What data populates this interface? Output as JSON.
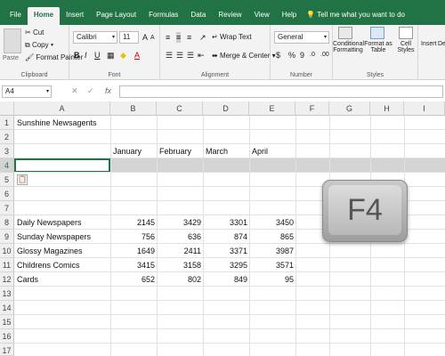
{
  "tabs": [
    "File",
    "Home",
    "Insert",
    "Page Layout",
    "Formulas",
    "Data",
    "Review",
    "View",
    "Help"
  ],
  "tell_me": "Tell me what you want to do",
  "clipboard": {
    "paste": "Paste",
    "cut": "Cut",
    "copy": "Copy",
    "format_painter": "Format Painter",
    "label": "Clipboard"
  },
  "font": {
    "name": "Calibri",
    "size": "11",
    "bold": "B",
    "italic": "I",
    "underline": "U",
    "grow": "A",
    "shrink": "A",
    "label": "Font"
  },
  "alignment": {
    "wrap": "Wrap Text",
    "merge": "Merge & Center",
    "label": "Alignment"
  },
  "number": {
    "format": "General",
    "currency": "$",
    "percent": "%",
    "comma": "9",
    "label": "Number"
  },
  "styles": {
    "conditional": "Conditional",
    "conditional2": "Formatting",
    "format_as": "Format as",
    "format_as2": "Table",
    "cell": "Cell",
    "cell2": "Styles",
    "label": "Styles"
  },
  "cells": {
    "insert": "Insert",
    "delete": "De"
  },
  "formula_bar": {
    "name_box": "A4",
    "fx": "fx",
    "cancel": "✕",
    "enter": "✓"
  },
  "columns": [
    "A",
    "B",
    "C",
    "D",
    "E",
    "F",
    "G",
    "H",
    "I"
  ],
  "rows": [
    "1",
    "2",
    "3",
    "4",
    "5",
    "6",
    "7",
    "8",
    "9",
    "10",
    "11",
    "12",
    "13",
    "14",
    "15",
    "16",
    "17"
  ],
  "sheet": {
    "title": "Sunshine Newsagents",
    "months": [
      "January",
      "February",
      "March",
      "April"
    ],
    "data": [
      {
        "label": "Daily Newspapers",
        "values": [
          "2145",
          "3429",
          "3301",
          "3450"
        ]
      },
      {
        "label": "Sunday Newspapers",
        "values": [
          "756",
          "636",
          "874",
          "865"
        ]
      },
      {
        "label": "Glossy Magazines",
        "values": [
          "1649",
          "2411",
          "3371",
          "3987"
        ]
      },
      {
        "label": "Childrens Comics",
        "values": [
          "3415",
          "3158",
          "3295",
          "3571"
        ]
      },
      {
        "label": "Cards",
        "values": [
          "652",
          "802",
          "849",
          "95"
        ]
      }
    ]
  },
  "key_overlay": "F4",
  "colors": {
    "accent": "#217346",
    "selected_row": "#d4d4d4"
  }
}
